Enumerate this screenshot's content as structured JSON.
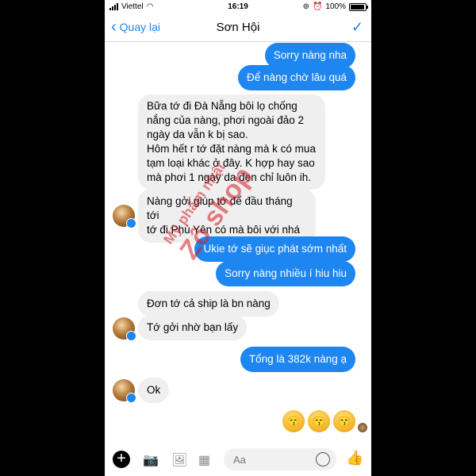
{
  "status": {
    "carrier": "Viettel",
    "time": "16:19",
    "battery": "100%"
  },
  "header": {
    "back_label": "Quay lại",
    "title": "Sơn Hội",
    "done_icon": "checkmark-icon"
  },
  "messages": [
    {
      "dir": "out",
      "text": "Sorry nàng nha"
    },
    {
      "dir": "out",
      "text": "Để nàng chờ lâu quá"
    },
    {
      "dir": "in",
      "lines": [
        "Bữa tớ đi Đà Nẵng bôi lọ chống",
        "nắng của nàng, phơi ngoài đảo 2",
        "ngày da vẫn k bị sao.",
        "Hôm hết r tớ đặt nàng mà k có mua",
        "tạm loại khác ở đây. K hợp hay sao",
        "mà phơi 1 ngày da đen chỉ luôn ih."
      ]
    },
    {
      "dir": "in",
      "lines": [
        "Nàng gởi giúp tớ để đầu tháng tới",
        "tớ đi Phú Yên có mà bôi với nhá"
      ]
    },
    {
      "dir": "out",
      "text": "Ukie tớ sẽ giục phát sớm nhất"
    },
    {
      "dir": "out",
      "text": "Sorry nàng nhiều í hiu hiu"
    },
    {
      "dir": "in",
      "text": "Đơn tớ cả ship là bn nàng"
    },
    {
      "dir": "in",
      "text": "Tớ gởi nhờ bạn lấy"
    },
    {
      "dir": "out",
      "text": "Tổng là 382k nàng ạ"
    },
    {
      "dir": "in",
      "text": "Ok"
    }
  ],
  "emojis": [
    "😙",
    "😙",
    "😙"
  ],
  "watermark": {
    "line1": "Mỹ phẩm nhật",
    "line2": "Zô shop"
  },
  "composer": {
    "placeholder": "Aa"
  },
  "colors": {
    "accent": "#1e86f0",
    "incoming_bg": "#efefef"
  }
}
